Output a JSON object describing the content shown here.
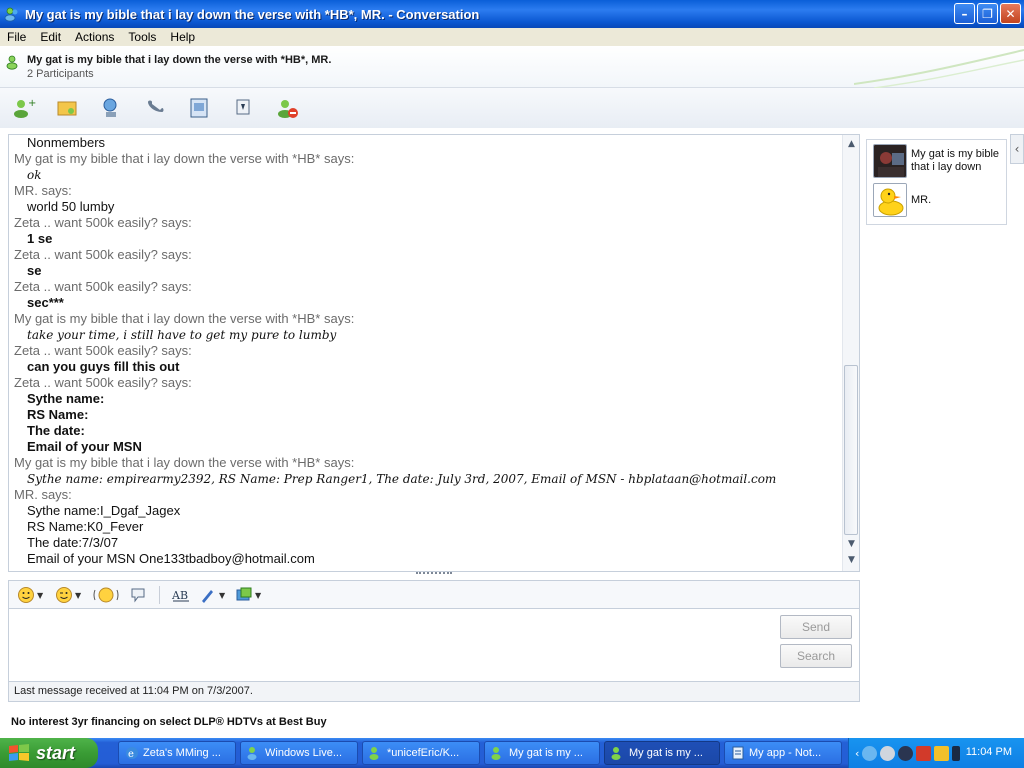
{
  "window": {
    "title": "My gat is my bible that i lay down the verse with *HB*, MR. - Conversation",
    "buttons": {
      "minimize": "–",
      "maximize": "❐",
      "close": "✕"
    }
  },
  "menu": [
    "File",
    "Edit",
    "Actions",
    "Tools",
    "Help"
  ],
  "header": {
    "title": "My gat is my bible that i lay down the verse with *HB*, MR.",
    "subtitle": "2 Participants"
  },
  "toolbar": {
    "icons": [
      "invite-contact-icon",
      "share-files-icon",
      "video-call-icon",
      "phone-icon",
      "activities-icon",
      "games-icon",
      "block-icon"
    ]
  },
  "history": [
    {
      "type": "body",
      "text": "Nonmembers",
      "style": "normal"
    },
    {
      "type": "says",
      "text": "My gat is my bible that i lay down the verse with *HB* says:"
    },
    {
      "type": "body",
      "text": "ok",
      "style": "script"
    },
    {
      "type": "says",
      "text": "MR. says:"
    },
    {
      "type": "body",
      "text": "world 50 lumby",
      "style": "normal"
    },
    {
      "type": "says",
      "text": "Zeta .. want 500k easily? says:"
    },
    {
      "type": "body",
      "text": "1 se",
      "style": "bold"
    },
    {
      "type": "says",
      "text": "Zeta .. want 500k easily? says:"
    },
    {
      "type": "body",
      "text": "se",
      "style": "bold"
    },
    {
      "type": "says",
      "text": "Zeta .. want 500k easily? says:"
    },
    {
      "type": "body",
      "text": "sec***",
      "style": "bold"
    },
    {
      "type": "says",
      "text": "My gat is my bible that i lay down the verse with *HB* says:"
    },
    {
      "type": "body",
      "text": "take your time, i still have to get my pure to lumby",
      "style": "script"
    },
    {
      "type": "says",
      "text": "Zeta .. want 500k easily? says:"
    },
    {
      "type": "body",
      "text": "can you guys fill this out",
      "style": "bold"
    },
    {
      "type": "says",
      "text": "Zeta .. want 500k easily? says:"
    },
    {
      "type": "body",
      "text": "Sythe name:",
      "style": "bold"
    },
    {
      "type": "body",
      "text": "RS Name:",
      "style": "bold"
    },
    {
      "type": "body",
      "text": "The date:",
      "style": "bold"
    },
    {
      "type": "body",
      "text": "Email of your MSN",
      "style": "bold"
    },
    {
      "type": "says",
      "text": "My gat is my bible that i lay down the verse with *HB* says:"
    },
    {
      "type": "body",
      "text": "Sythe name: empirearmy2392, RS Name: Prep Ranger1, The date: July 3rd, 2007, Email of MSN - hbplataan@hotmail.com",
      "style": "script"
    },
    {
      "type": "says",
      "text": "MR. says:"
    },
    {
      "type": "body",
      "text": "Sythe name:I_Dgaf_Jagex",
      "style": "normal"
    },
    {
      "type": "body",
      "text": "RS Name:K0_Fever",
      "style": "normal"
    },
    {
      "type": "body",
      "text": "The date:7/3/07",
      "style": "normal"
    },
    {
      "type": "body",
      "text": "Email of your MSN One133tbadboy@hotmail.com",
      "style": "normal"
    }
  ],
  "compose": {
    "send_label": "Send",
    "search_label": "Search"
  },
  "status": "Last message received at 11:04 PM on 7/3/2007.",
  "ad": "No interest 3yr financing on select DLP® HDTVs at Best Buy",
  "participants": [
    {
      "name": "My gat is my bible that i lay down"
    },
    {
      "name": "MR."
    }
  ],
  "taskbar": {
    "start_label": "start",
    "tasks": [
      {
        "label": "Zeta's MMing ...",
        "active": false
      },
      {
        "label": "Windows Live...",
        "active": false
      },
      {
        "label": "*unicefEric/K...",
        "active": false
      },
      {
        "label": "My gat is my ...",
        "active": false
      },
      {
        "label": "My gat is my ...",
        "active": true
      },
      {
        "label": "My app - Not...",
        "active": false
      }
    ],
    "clock": "11:04 PM"
  },
  "colors": {
    "titlebar": "#0a5fd8",
    "taskbar": "#245dd5",
    "start": "#3a9c35",
    "says_text": "#6b6b6b"
  }
}
